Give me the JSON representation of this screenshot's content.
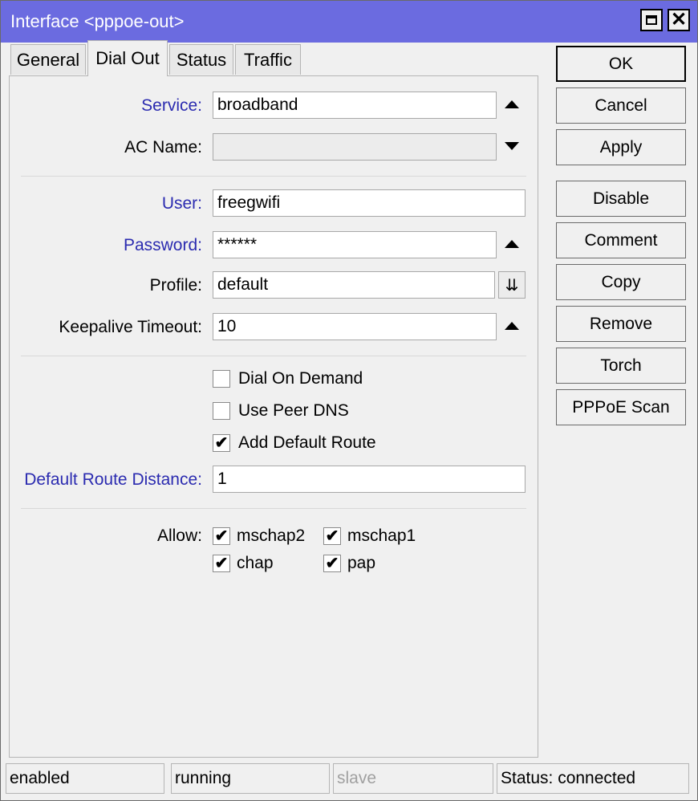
{
  "window": {
    "title": "Interface <pppoe-out>"
  },
  "tabs": [
    {
      "label": "General",
      "active": false
    },
    {
      "label": "Dial Out",
      "active": true
    },
    {
      "label": "Status",
      "active": false
    },
    {
      "label": "Traffic",
      "active": false
    }
  ],
  "form": {
    "service": {
      "label": "Service:",
      "value": "broadband"
    },
    "ac_name": {
      "label": "AC Name:",
      "value": ""
    },
    "user": {
      "label": "User:",
      "value": "freegwifi"
    },
    "password": {
      "label": "Password:",
      "value": "******"
    },
    "profile": {
      "label": "Profile:",
      "value": "default"
    },
    "keepalive": {
      "label": "Keepalive Timeout:",
      "value": "10"
    },
    "dial_on_demand": {
      "label": "Dial On Demand",
      "checked": false
    },
    "use_peer_dns": {
      "label": "Use Peer DNS",
      "checked": false
    },
    "add_default_route": {
      "label": "Add Default Route",
      "checked": true
    },
    "default_route_distance": {
      "label": "Default Route Distance:",
      "value": "1"
    },
    "allow": {
      "label": "Allow:",
      "mschap2": {
        "label": "mschap2",
        "checked": true
      },
      "mschap1": {
        "label": "mschap1",
        "checked": true
      },
      "chap": {
        "label": "chap",
        "checked": true
      },
      "pap": {
        "label": "pap",
        "checked": true
      }
    }
  },
  "buttons": {
    "ok": "OK",
    "cancel": "Cancel",
    "apply": "Apply",
    "disable": "Disable",
    "comment": "Comment",
    "copy": "Copy",
    "remove": "Remove",
    "torch": "Torch",
    "pppoe_scan": "PPPoE Scan"
  },
  "statusbar": {
    "enabled": "enabled",
    "running": "running",
    "slave": "slave",
    "status": "Status: connected"
  },
  "glyphs": {
    "check": "✔",
    "close": "✕",
    "dropdown": "⇊"
  },
  "colors": {
    "titlebar": "#6b6be0",
    "blue_label": "#2b2bb0"
  }
}
